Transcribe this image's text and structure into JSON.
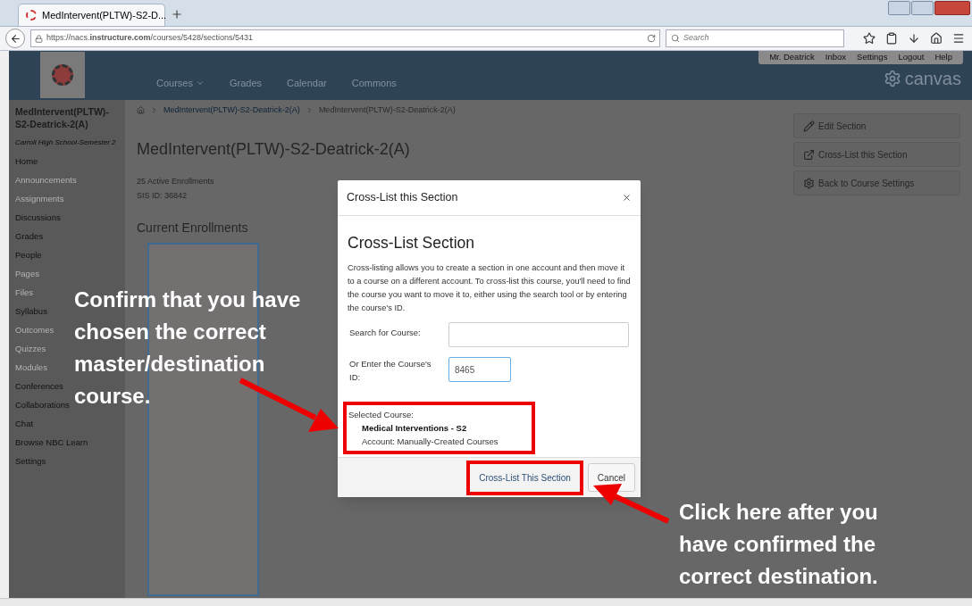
{
  "browser": {
    "tab_title": "MedIntervent(PLTW)-S2-D...",
    "url": "https://nacs.**instructure.com**/courses/5428/sections/5431",
    "search_placeholder": "Search"
  },
  "header": {
    "nav": [
      {
        "label": "Courses",
        "dropdown": true
      },
      {
        "label": "Grades",
        "dropdown": false
      },
      {
        "label": "Calendar",
        "dropdown": false
      },
      {
        "label": "Commons",
        "dropdown": false
      }
    ],
    "user_links": [
      "Mr. Deatrick",
      "Inbox",
      "Settings",
      "Logout",
      "Help"
    ],
    "brand": "canvas"
  },
  "sidebar": {
    "course": "MedIntervent(PLTW)-S2-Deatrick-2(A)",
    "term": "Carroll High School-Semester 2",
    "items": [
      {
        "label": "Home",
        "disabled": false
      },
      {
        "label": "Announcements",
        "disabled": true
      },
      {
        "label": "Assignments",
        "disabled": true
      },
      {
        "label": "Discussions",
        "disabled": false
      },
      {
        "label": "Grades",
        "disabled": false
      },
      {
        "label": "People",
        "disabled": false
      },
      {
        "label": "Pages",
        "disabled": true
      },
      {
        "label": "Files",
        "disabled": true
      },
      {
        "label": "Syllabus",
        "disabled": false
      },
      {
        "label": "Outcomes",
        "disabled": true
      },
      {
        "label": "Quizzes",
        "disabled": true
      },
      {
        "label": "Modules",
        "disabled": true
      },
      {
        "label": "Conferences",
        "disabled": false
      },
      {
        "label": "Collaborations",
        "disabled": false
      },
      {
        "label": "Chat",
        "disabled": false
      },
      {
        "label": "Browse NBC Learn",
        "disabled": false
      },
      {
        "label": "Settings",
        "disabled": false
      }
    ]
  },
  "breadcrumb": [
    "MedIntervent(PLTW)-S2-Deatrick-2(A)",
    "MedIntervent(PLTW)-S2-Deatrick-2(A)"
  ],
  "main": {
    "title": "MedIntervent(PLTW)-S2-Deatrick-2(A)",
    "enrollments": "25 Active Enrollments",
    "sis_id": "SIS ID: 36842",
    "section_heading": "Current Enrollments"
  },
  "actions": [
    {
      "kind": "edit",
      "label": "Edit Section"
    },
    {
      "kind": "crosslist",
      "label": "Cross-List this Section"
    },
    {
      "kind": "settings",
      "label": "Back to Course Settings"
    }
  ],
  "dialog": {
    "title": "Cross-List this Section",
    "heading": "Cross-List Section",
    "description": "Cross-listing allows you to create a section in one account and then move it to a course on a different account. To cross-list this course, you'll need to find the course you want to move it to, either using the search tool or by entering the course's ID.",
    "search_label": "Search for Course:",
    "id_label": "Or Enter the Course's ID:",
    "id_value": "8465",
    "selected_label": "Selected Course:",
    "selected_name": "Medical Interventions - S2",
    "selected_account": "Account: Manually-Created Courses",
    "submit": "Cross-List This Section",
    "cancel": "Cancel"
  },
  "annotations": [
    "Confirm that you have\nchosen the correct\nmaster/destination\ncourse.",
    "Click here after you\nhave confirmed the\ncorrect destination."
  ]
}
